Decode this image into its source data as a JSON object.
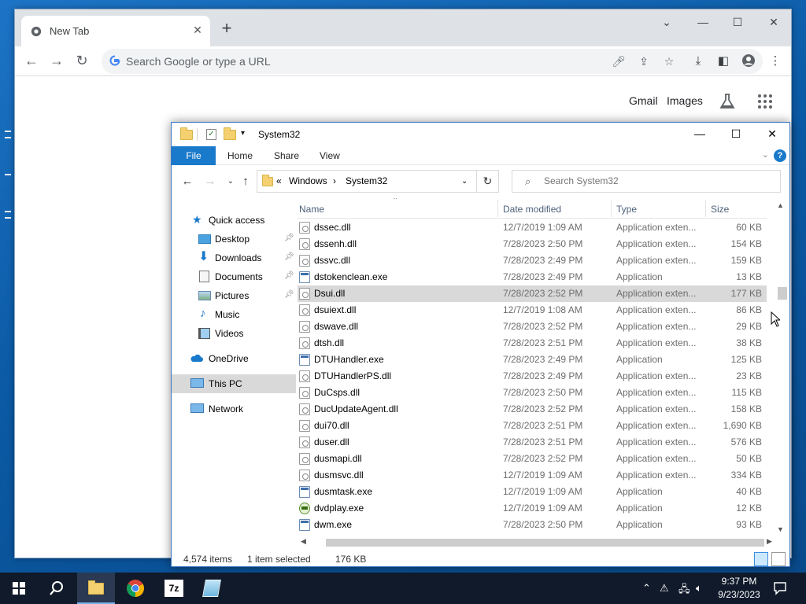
{
  "chrome": {
    "tab_title": "New Tab",
    "omnibox_placeholder": "Search Google or type a URL",
    "ntp_links": {
      "gmail": "Gmail",
      "images": "Images"
    }
  },
  "explorer": {
    "title": "System32",
    "ribbon": [
      "File",
      "Home",
      "Share",
      "View"
    ],
    "address": {
      "prefix": "«",
      "segments": [
        "Windows",
        "System32"
      ]
    },
    "search_placeholder": "Search System32",
    "nav": {
      "quick_access": "Quick access",
      "desktop": "Desktop",
      "downloads": "Downloads",
      "documents": "Documents",
      "pictures": "Pictures",
      "music": "Music",
      "videos": "Videos",
      "onedrive": "OneDrive",
      "this_pc": "This PC",
      "network": "Network"
    },
    "columns": {
      "name": "Name",
      "date": "Date modified",
      "type": "Type",
      "size": "Size"
    },
    "files": [
      {
        "name": "dssec.dll",
        "date": "12/7/2019 1:09 AM",
        "type": "Application exten...",
        "size": "60 KB",
        "kind": "dll"
      },
      {
        "name": "dssenh.dll",
        "date": "7/28/2023 2:50 PM",
        "type": "Application exten...",
        "size": "154 KB",
        "kind": "dll"
      },
      {
        "name": "dssvc.dll",
        "date": "7/28/2023 2:49 PM",
        "type": "Application exten...",
        "size": "159 KB",
        "kind": "dll"
      },
      {
        "name": "dstokenclean.exe",
        "date": "7/28/2023 2:49 PM",
        "type": "Application",
        "size": "13 KB",
        "kind": "exe"
      },
      {
        "name": "Dsui.dll",
        "date": "7/28/2023 2:52 PM",
        "type": "Application exten...",
        "size": "177 KB",
        "kind": "dll",
        "selected": true
      },
      {
        "name": "dsuiext.dll",
        "date": "12/7/2019 1:08 AM",
        "type": "Application exten...",
        "size": "86 KB",
        "kind": "dll"
      },
      {
        "name": "dswave.dll",
        "date": "7/28/2023 2:52 PM",
        "type": "Application exten...",
        "size": "29 KB",
        "kind": "dll"
      },
      {
        "name": "dtsh.dll",
        "date": "7/28/2023 2:51 PM",
        "type": "Application exten...",
        "size": "38 KB",
        "kind": "dll"
      },
      {
        "name": "DTUHandler.exe",
        "date": "7/28/2023 2:49 PM",
        "type": "Application",
        "size": "125 KB",
        "kind": "exe"
      },
      {
        "name": "DTUHandlerPS.dll",
        "date": "7/28/2023 2:49 PM",
        "type": "Application exten...",
        "size": "23 KB",
        "kind": "dll"
      },
      {
        "name": "DuCsps.dll",
        "date": "7/28/2023 2:50 PM",
        "type": "Application exten...",
        "size": "115 KB",
        "kind": "dll"
      },
      {
        "name": "DucUpdateAgent.dll",
        "date": "7/28/2023 2:52 PM",
        "type": "Application exten...",
        "size": "158 KB",
        "kind": "dll"
      },
      {
        "name": "dui70.dll",
        "date": "7/28/2023 2:51 PM",
        "type": "Application exten...",
        "size": "1,690 KB",
        "kind": "dll"
      },
      {
        "name": "duser.dll",
        "date": "7/28/2023 2:51 PM",
        "type": "Application exten...",
        "size": "576 KB",
        "kind": "dll"
      },
      {
        "name": "dusmapi.dll",
        "date": "7/28/2023 2:52 PM",
        "type": "Application exten...",
        "size": "50 KB",
        "kind": "dll"
      },
      {
        "name": "dusmsvc.dll",
        "date": "12/7/2019 1:09 AM",
        "type": "Application exten...",
        "size": "334 KB",
        "kind": "dll"
      },
      {
        "name": "dusmtask.exe",
        "date": "12/7/2019 1:09 AM",
        "type": "Application",
        "size": "40 KB",
        "kind": "exe"
      },
      {
        "name": "dvdplay.exe",
        "date": "12/7/2019 1:09 AM",
        "type": "Application",
        "size": "12 KB",
        "kind": "dvd"
      },
      {
        "name": "dwm.exe",
        "date": "7/28/2023 2:50 PM",
        "type": "Application",
        "size": "93 KB",
        "kind": "exe"
      }
    ],
    "status": {
      "items": "4,574 items",
      "selected": "1 item selected",
      "size": "176 KB"
    }
  },
  "taskbar": {
    "time": "9:37 PM",
    "date": "9/23/2023",
    "apps": [
      "start",
      "search",
      "file-explorer",
      "chrome",
      "7-zip",
      "notepad"
    ]
  },
  "colors": {
    "accent": "#1979ca",
    "selection": "#d9d9d9",
    "taskbar": "#101a2a"
  }
}
